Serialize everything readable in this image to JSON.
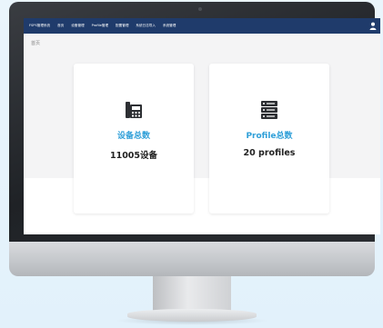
{
  "nav": {
    "items": [
      "FSPS管理系统",
      "首页",
      "设备管理",
      "Profile管理",
      "配置管理",
      "系统日志导入",
      "系统管理"
    ]
  },
  "breadcrumb": "首页",
  "cards": [
    {
      "title": "设备总数",
      "value": "11005设备",
      "icon": "phone-device-icon"
    },
    {
      "title": "Profile总数",
      "value": "20 profiles",
      "icon": "server-stack-icon"
    }
  ],
  "colors": {
    "navbar": "#1f3b6b",
    "accent": "#2f9fd8",
    "value_text": "#222222"
  }
}
